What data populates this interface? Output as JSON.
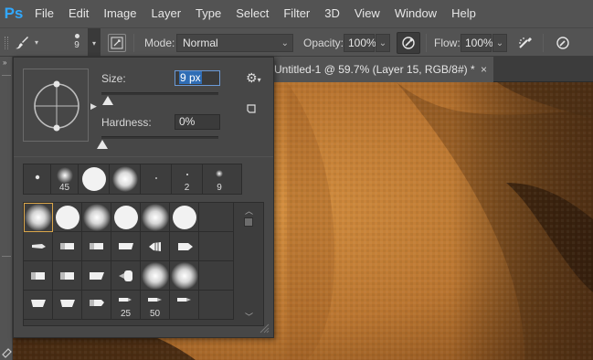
{
  "app": {
    "logo": "Ps",
    "menu": [
      "File",
      "Edit",
      "Image",
      "Layer",
      "Type",
      "Select",
      "Filter",
      "3D",
      "View",
      "Window",
      "Help"
    ]
  },
  "options_bar": {
    "brush_size_value": "9",
    "mode_label": "Mode:",
    "mode_value": "Normal",
    "opacity_label": "Opacity:",
    "opacity_value": "100%",
    "flow_label": "Flow:",
    "flow_value": "100%",
    "icons": [
      "brush-tool-icon",
      "toggle-brush-panel-icon",
      "pressure-opacity-icon",
      "airbrush-icon",
      "pressure-size-icon"
    ]
  },
  "document": {
    "tab_title": "Untitled-1 @ 59.7% (Layer 15, RGB/8#) *",
    "close_glyph": "×"
  },
  "brush_picker": {
    "size_label": "Size:",
    "size_value": "9 px",
    "hardness_label": "Hardness:",
    "hardness_value": "0%",
    "size_level": 0.01,
    "hardness_level": 0.0,
    "recent_brushes": [
      {
        "kind": "hard-small",
        "label": ""
      },
      {
        "kind": "soft-medium",
        "label": "45"
      },
      {
        "kind": "hard-large",
        "label": ""
      },
      {
        "kind": "soft-large",
        "label": ""
      },
      {
        "kind": "dot-tiny",
        "label": ""
      },
      {
        "kind": "dot-tiny",
        "label": "2"
      },
      {
        "kind": "soft-small",
        "label": "9"
      }
    ],
    "preset_rows": [
      [
        {
          "kind": "soft-large",
          "label": ""
        },
        {
          "kind": "hard-large",
          "label": ""
        },
        {
          "kind": "soft-large",
          "label": ""
        },
        {
          "kind": "hard-large",
          "label": ""
        },
        {
          "kind": "soft-large",
          "label": ""
        },
        {
          "kind": "hard-large",
          "label": ""
        }
      ],
      [
        {
          "kind": "tip-a",
          "label": ""
        },
        {
          "kind": "tip-b",
          "label": ""
        },
        {
          "kind": "tip-b",
          "label": ""
        },
        {
          "kind": "tip-c",
          "label": ""
        },
        {
          "kind": "tip-d",
          "label": ""
        },
        {
          "kind": "tip-e",
          "label": ""
        }
      ],
      [
        {
          "kind": "tip-f",
          "label": ""
        },
        {
          "kind": "tip-f",
          "label": ""
        },
        {
          "kind": "tip-g",
          "label": ""
        },
        {
          "kind": "tip-h",
          "label": ""
        },
        {
          "kind": "soft-large",
          "label": ""
        },
        {
          "kind": "soft-large",
          "label": ""
        }
      ],
      [
        {
          "kind": "tip-i",
          "label": ""
        },
        {
          "kind": "tip-i",
          "label": ""
        },
        {
          "kind": "tip-j",
          "label": ""
        },
        {
          "kind": "tip-k",
          "label": "25"
        },
        {
          "kind": "tip-l",
          "label": "50"
        },
        {
          "kind": "tip-m",
          "label": ""
        }
      ]
    ]
  }
}
